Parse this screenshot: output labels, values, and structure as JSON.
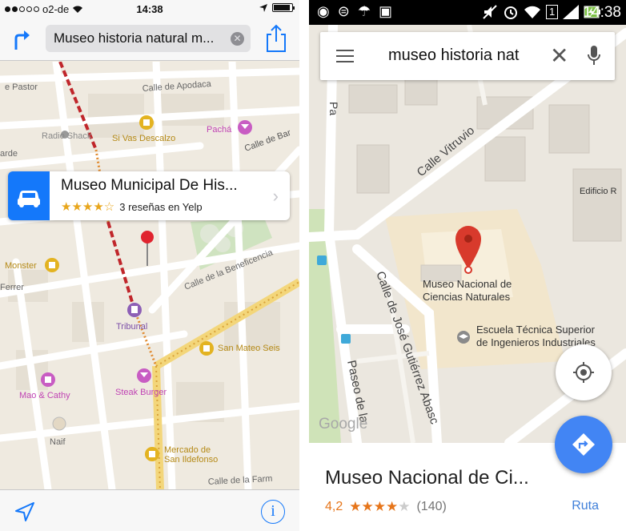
{
  "left": {
    "status": {
      "carrier": "o2-de",
      "time": "14:38"
    },
    "search": {
      "query": "Museo historia natural m..."
    },
    "map_labels": {
      "calle_pastor": "e Pastor",
      "calle_apodaca": "Calle de Apodaca",
      "radio_shack": "Radio Shack",
      "pacha": "Pachá",
      "si_vas_descalzo": "Si Vas Descalzo",
      "calle_barco": "Calle de Bar",
      "arde": "arde",
      "monster": "Monster",
      "ferrer": "Ferrer",
      "calle_beneficencia": "Calle de la Beneficencia",
      "tribunal": "Tribunal",
      "san_mateo_seis": "San Mateo Seis",
      "mao_cathy": "Mao & Cathy",
      "steak_burger": "Steak Burger",
      "naif": "Naif",
      "mercado": "Mercado de",
      "san_ildefonso": "San Ildefonso",
      "calle_farmacia": "Calle de la Farm"
    },
    "callout": {
      "title": "Museo Municipal De His...",
      "stars": "★★★★☆",
      "reviews": "3 reseñas en Yelp"
    },
    "toolbar": {
      "info_label": "i"
    }
  },
  "right": {
    "status": {
      "time": "14:38",
      "sim": "1"
    },
    "search": {
      "query": "museo historia nat"
    },
    "map_labels": {
      "calle_vitruvio": "Calle Vitruvio",
      "edificio": "Edificio R",
      "museo_line1": "Museo Nacional de",
      "museo_line2": "Ciencias Naturales",
      "escuela_line1": "Escuela Técnica Superior",
      "escuela_line2": "de Ingenieros Industriales",
      "calle_gutierrez": "Calle de José Gutiérrez Abasc",
      "paseo": "Paseo de la",
      "pa": "Pa",
      "google": "Google"
    },
    "card": {
      "name": "Museo Nacional de Ci...",
      "score": "4,2",
      "stars_full": "★★★★",
      "stars_empty": "★",
      "count": "(140)",
      "route": "Ruta"
    },
    "colors": {
      "blue_fab": "#4285f4",
      "pin_red": "#d83a2c",
      "ios_blue": "#1478fa",
      "star_orange": "#e6751a"
    }
  }
}
